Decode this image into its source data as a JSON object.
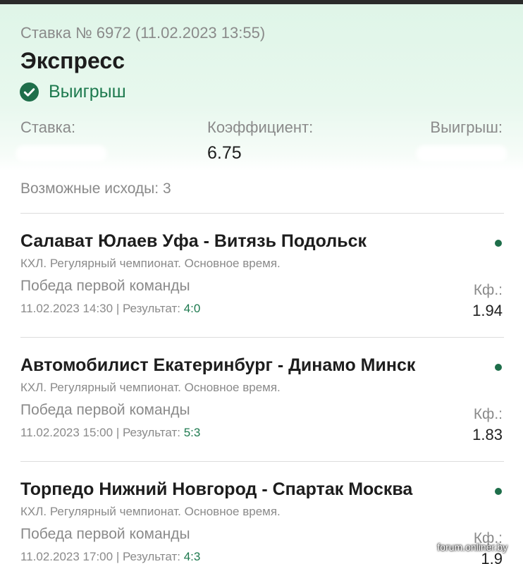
{
  "bet": {
    "meta": "Ставка № 6972 (11.02.2023 13:55)",
    "type": "Экспресс",
    "status": "Выигрыш",
    "status_icon": "check-circle-icon",
    "status_color": "#1e7a4f",
    "stake_label": "Ставка:",
    "coef_label": "Коэффициент:",
    "coef_value": "6.75",
    "win_label": "Выигрыш:",
    "outcomes": "Возможные исходы: 3"
  },
  "events": [
    {
      "title": "Салават Юлаев Уфа - Витязь Подольск",
      "league": "КХЛ. Регулярный чемпионат. Основное время.",
      "pick": "Победа первой команды",
      "datetime": "11.02.2023 14:30",
      "result_label": " | Результат: ",
      "score": "4:0",
      "kf_label": "Кф.:",
      "kf_value": "1.94"
    },
    {
      "title": "Автомобилист Екатеринбург - Динамо Минск",
      "league": "КХЛ. Регулярный чемпионат. Основное время.",
      "pick": "Победа первой команды",
      "datetime": "11.02.2023 15:00",
      "result_label": " | Результат: ",
      "score": "5:3",
      "kf_label": "Кф.:",
      "kf_value": "1.83"
    },
    {
      "title": "Торпедо Нижний Новгород - Спартак Москва",
      "league": "КХЛ. Регулярный чемпионат. Основное время.",
      "pick": "Победа первой команды",
      "datetime": "11.02.2023 17:00",
      "result_label": " | Результат: ",
      "score": "4:3",
      "kf_label": "Кф.:",
      "kf_value": "1.9"
    }
  ],
  "watermark": "forum.onliner.by"
}
